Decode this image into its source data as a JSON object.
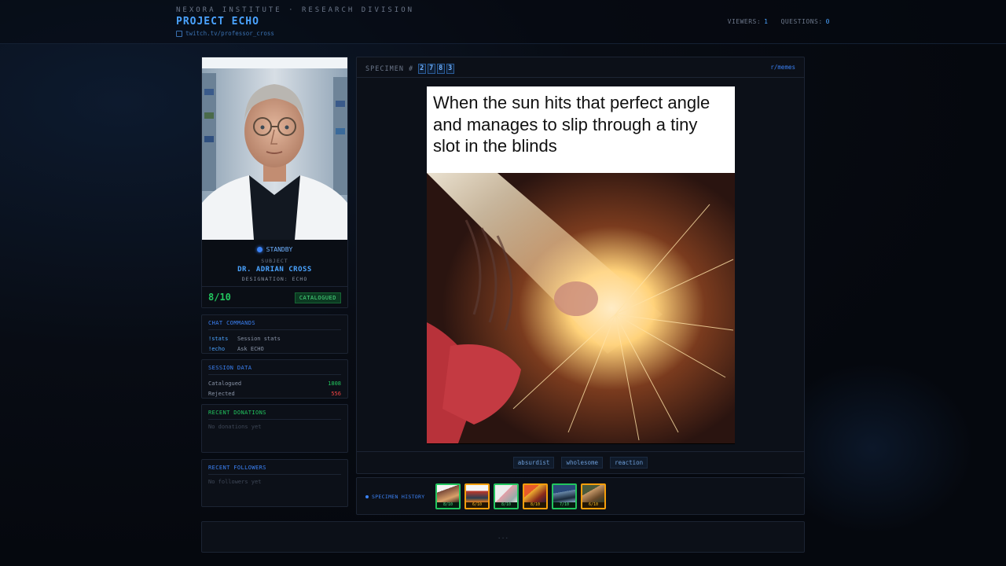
{
  "header": {
    "org": "NEXORA INSTITUTE · RESEARCH DIVISION",
    "project": "PROJECT ECHO",
    "channel": "twitch.tv/professor_cross",
    "viewers_label": "VIEWERS:",
    "viewers": "1",
    "questions_label": "QUESTIONS:",
    "questions": "0"
  },
  "subject": {
    "status": "STANDBY",
    "label": "SUBJECT",
    "name": "DR. ADRIAN CROSS",
    "designation": "DESIGNATION: ECHO",
    "score": "8/10",
    "badge": "CATALOGUED"
  },
  "commands": {
    "title": "CHAT COMMANDS",
    "items": [
      {
        "key": "!stats",
        "desc": "Session stats"
      },
      {
        "key": "!echo",
        "desc": "Ask ECHO"
      }
    ]
  },
  "session": {
    "title": "SESSION DATA",
    "catalogued_label": "Catalogued",
    "catalogued": "1808",
    "rejected_label": "Rejected",
    "rejected": "556"
  },
  "donations": {
    "title": "RECENT DONATIONS",
    "empty": "No donations yet"
  },
  "followers": {
    "title": "RECENT FOLLOWERS",
    "empty": "No followers yet"
  },
  "specimen": {
    "label": "SPECIMEN #",
    "digits": [
      "2",
      "7",
      "8",
      "3"
    ],
    "subreddit": "r/memes",
    "caption": "When the sun hits that perfect angle and manages to slip through a tiny slot in the blinds",
    "tags": [
      "absurdist",
      "wholesome",
      "reaction"
    ]
  },
  "history": {
    "label": "SPECIMEN HISTORY",
    "items": [
      {
        "score": "8/10",
        "tier": "green"
      },
      {
        "score": "6/10",
        "tier": "orange"
      },
      {
        "score": "8/10",
        "tier": "green"
      },
      {
        "score": "8/10",
        "tier": "orange"
      },
      {
        "score": "7/10",
        "tier": "green"
      },
      {
        "score": "6/10",
        "tier": "orange"
      }
    ]
  },
  "footer": {
    "text": "..."
  },
  "colors": {
    "accent": "#4aa3ff",
    "positive": "#22c55e",
    "negative": "#ef4444",
    "warning": "#f59e0b",
    "background": "#06090f"
  }
}
